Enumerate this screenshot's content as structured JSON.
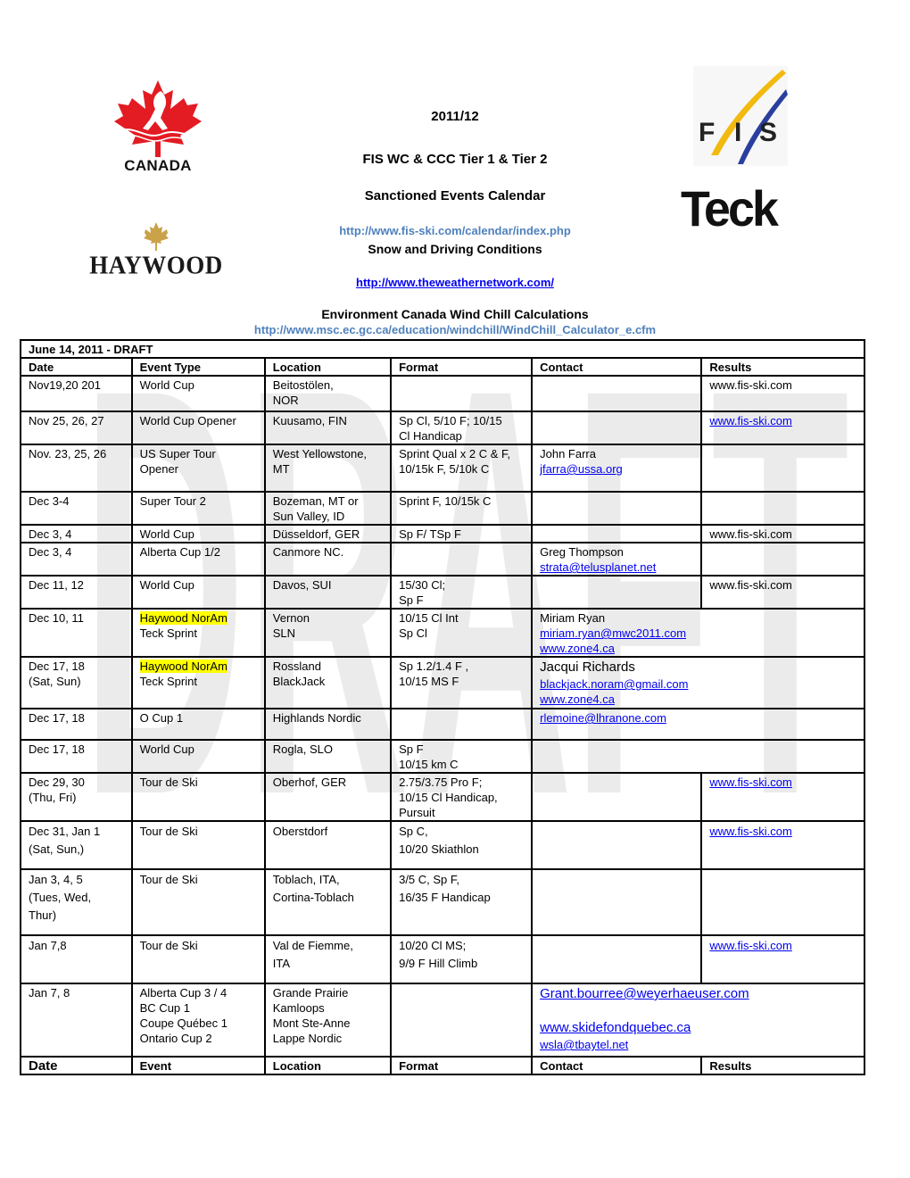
{
  "logos": {
    "canada": {
      "label": "CANADA",
      "icon": "maple-leaf-skier-icon",
      "color": "#e31b23"
    },
    "haywood": {
      "label": "HAYWOOD",
      "icon": "maple-leaf-icon",
      "color": "#c9a24a"
    },
    "fis": {
      "label": "F I S",
      "icon": "fis-swoosh-icon",
      "swoosh_colors": [
        "#f2b90f",
        "#2a3f9d"
      ]
    },
    "teck": {
      "label": "Teck"
    }
  },
  "header": {
    "season": "2011/12",
    "title": "FIS WC & CCC Tier 1 & Tier 2",
    "subtitle": "Sanctioned Events Calendar",
    "fis_calendar_link": "http://www.fis-ski.com/calendar/index.php",
    "conditions_heading": "Snow and Driving Conditions",
    "weather_link": "http://www.theweathernetwork.com/",
    "windchill_heading": "Environment Canada Wind Chill Calculations",
    "windchill_link": "http://www.msc.ec.gc.ca/education/windchill/WindChill_Calculator_e.cfm"
  },
  "watermark": {
    "text": "DRAFT",
    "color": "#ebebeb"
  },
  "table": {
    "draft_label": "June 14, 2011 - DRAFT",
    "columns": [
      "Date",
      "Event Type",
      "Location",
      "Format",
      "Contact",
      "Results"
    ],
    "footer_columns": [
      "Date",
      "Event",
      "Location",
      "Format",
      "Contact",
      "Results"
    ],
    "highlight_color": "#ffff00",
    "rows": [
      {
        "date": [
          "Nov19,20 201"
        ],
        "event": [
          "World Cup"
        ],
        "location": [
          "Beitostölen,",
          "NOR"
        ],
        "format": [],
        "contact": [],
        "results": [
          "www.fis-ski.com"
        ]
      },
      {
        "date": [
          "Nov 25, 26, 27"
        ],
        "event": [
          "World Cup Opener"
        ],
        "location": [
          "Kuusamo, FIN"
        ],
        "format": [
          "Sp Cl, 5/10 F; 10/15",
          "Cl Handicap"
        ],
        "contact": [],
        "results": [
          "www.fis-ski.com"
        ]
      },
      {
        "date": [
          "Nov. 23, 25, 26"
        ],
        "event": [
          "US Super Tour",
          "Opener"
        ],
        "location": [
          "West Yellowstone,",
          "MT"
        ],
        "format": [
          "Sprint Qual x 2 C & F,",
          "10/15k F,   5/10k C"
        ],
        "contact": [
          "John Farra",
          "jfarra@ussa.org"
        ],
        "results": []
      },
      {
        "date": [
          "Dec 3-4"
        ],
        "event": [
          "Super Tour 2"
        ],
        "location": [
          "Bozeman, MT or",
          "Sun Valley, ID"
        ],
        "format": [
          "Sprint F, 10/15k C"
        ],
        "contact": [],
        "results": []
      },
      {
        "date": [
          "Dec  3, 4"
        ],
        "event": [
          "World Cup"
        ],
        "location": [
          "Düsseldorf, GER"
        ],
        "format": [
          "Sp F/ TSp F"
        ],
        "contact": [],
        "results": [
          "www.fis-ski.com"
        ]
      },
      {
        "date": [
          "Dec 3, 4"
        ],
        "event": [
          "Alberta Cup 1/2"
        ],
        "location": [
          "Canmore NC."
        ],
        "format": [],
        "contact": [
          "Greg Thompson",
          "strata@telusplanet.net"
        ],
        "results": []
      },
      {
        "date": [
          "Dec 11, 12"
        ],
        "event": [
          "World Cup"
        ],
        "location": [
          "Davos, SUI"
        ],
        "format": [
          "15/30 Cl;",
          "Sp F"
        ],
        "contact": [],
        "results": [
          "www.fis-ski.com"
        ]
      },
      {
        "date": [
          "Dec  10, 11"
        ],
        "event": [
          "Haywood NorAm",
          "Teck Sprint"
        ],
        "location": [
          "Vernon",
          "SLN"
        ],
        "format": [
          "10/15 Cl  Int",
          " Sp Cl"
        ],
        "contact": [
          "Miriam Ryan",
          "miriam.ryan@mwc2011.com",
          "www.zone4.ca"
        ]
      },
      {
        "date": [
          "Dec   17, 18",
          "(Sat, Sun)"
        ],
        "event": [
          "Haywood NorAm",
          "Teck Sprint"
        ],
        "location": [
          "Rossland",
          "BlackJack"
        ],
        "format": [
          "Sp 1.2/1.4 F  ,",
          "10/15 MS F"
        ],
        "contact": [
          "Jacqui Richards",
          "blackjack.noram@gmail.com",
          "www.zone4.ca"
        ]
      },
      {
        "date": [
          "Dec 17, 18"
        ],
        "event": [
          "O Cup 1"
        ],
        "location": [
          "Highlands Nordic"
        ],
        "format": [],
        "contact": [
          "rlemoine@lhranone.com"
        ]
      },
      {
        "date": [
          "Dec 17, 18"
        ],
        "event": [
          "World Cup"
        ],
        "location": [
          "Rogla, SLO"
        ],
        "format": [
          "Sp F",
          "10/15 km C"
        ],
        "contact": []
      },
      {
        "date": [
          "Dec 29, 30",
          "(Thu, Fri)"
        ],
        "event": [
          "Tour de Ski"
        ],
        "location": [
          "Oberhof, GER"
        ],
        "format": [
          "2.75/3.75 Pro F;",
          "10/15 Cl Handicap,",
          "Pursuit"
        ],
        "contact": [],
        "results": [
          "www.fis-ski.com"
        ]
      },
      {
        "date": [
          "Dec 31, Jan 1",
          "(Sat, Sun,)"
        ],
        "event": [
          "Tour de Ski"
        ],
        "location": [
          "Oberstdorf"
        ],
        "format": [
          "Sp C,",
          "10/20 Skiathlon"
        ],
        "contact": [],
        "results": [
          "www.fis-ski.com"
        ]
      },
      {
        "date": [
          "Jan 3, 4, 5",
          "(Tues, Wed,",
          "Thur)"
        ],
        "event": [
          "Tour de Ski"
        ],
        "location": [
          "Toblach, ITA,",
          "Cortina-Toblach"
        ],
        "format": [
          "3/5 C, Sp F,",
          "16/35 F Handicap"
        ],
        "contact": [],
        "results": []
      },
      {
        "date": [
          "Jan 7,8"
        ],
        "event": [
          "Tour de Ski"
        ],
        "location": [
          "Val de Fiemme,",
          "ITA"
        ],
        "format": [
          "10/20 Cl MS;",
          "9/9 F Hill Climb"
        ],
        "contact": [],
        "results": [
          "www.fis-ski.com"
        ]
      },
      {
        "date": [
          "Jan 7, 8"
        ],
        "event": [
          "Alberta Cup 3 / 4",
          "BC Cup 1",
          "Coupe Québec 1",
          "Ontario Cup 2"
        ],
        "location": [
          "Grande Prairie",
          "Kamloops",
          "Mont Ste-Anne",
          "Lappe Nordic"
        ],
        "format": [],
        "contact": [
          "Grant.bourree@weyerhaeuser.com",
          "www.skidefondquebec.ca",
          "wsla@tbaytel.net"
        ]
      }
    ]
  }
}
